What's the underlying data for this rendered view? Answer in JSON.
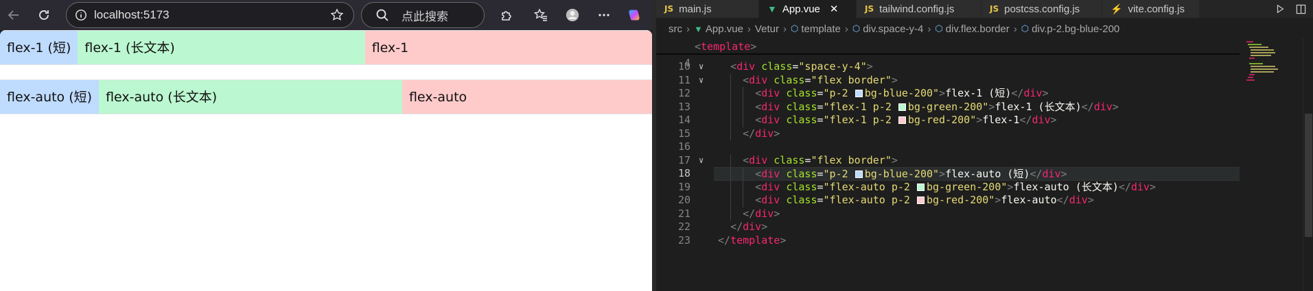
{
  "browser": {
    "url": "localhost:5173",
    "search_placeholder": "点此搜索"
  },
  "page": {
    "row1": [
      "flex-1 (短)",
      "flex-1 (长文本)",
      "flex-1"
    ],
    "row2": [
      "flex-auto (短)",
      "flex-auto (长文本)",
      "flex-auto"
    ]
  },
  "editor": {
    "tabs": [
      {
        "icon": "JS",
        "label": "main.js"
      },
      {
        "icon": "vue",
        "label": "App.vue",
        "close": "✕"
      },
      {
        "icon": "JS",
        "label": "tailwind.config.js"
      },
      {
        "icon": "JS",
        "label": "postcss.config.js"
      },
      {
        "icon": "vite",
        "label": "vite.config.js"
      }
    ],
    "breadcrumb": [
      "src",
      "App.vue",
      "Vetur",
      "template",
      "div.space-y-4",
      "div.flex.border",
      "div.p-2.bg-blue-200"
    ],
    "sticky_line": {
      "num": "4",
      "tag": "template"
    },
    "current_line": "18",
    "lines": [
      {
        "num": "10",
        "fold": "∨",
        "indent": 1,
        "tokens": [
          [
            "punc",
            "<"
          ],
          [
            "tag",
            "div"
          ],
          [
            "txt",
            " "
          ],
          [
            "attr",
            "class"
          ],
          [
            "eq",
            "="
          ],
          [
            "str",
            "\"space-y-4\""
          ],
          [
            "punc",
            ">"
          ]
        ]
      },
      {
        "num": "11",
        "fold": "∨",
        "indent": 2,
        "tokens": [
          [
            "punc",
            "<"
          ],
          [
            "tag",
            "div"
          ],
          [
            "txt",
            " "
          ],
          [
            "attr",
            "class"
          ],
          [
            "eq",
            "="
          ],
          [
            "str",
            "\"flex border\""
          ],
          [
            "punc",
            ">"
          ]
        ]
      },
      {
        "num": "12",
        "fold": "",
        "indent": 3,
        "tokens": [
          [
            "punc",
            "<"
          ],
          [
            "tag",
            "div"
          ],
          [
            "txt",
            " "
          ],
          [
            "attr",
            "class"
          ],
          [
            "eq",
            "="
          ],
          [
            "str",
            "\"p-2 "
          ],
          [
            "sw",
            "#bfdbfe"
          ],
          [
            "str",
            "bg-blue-200\""
          ],
          [
            "punc",
            ">"
          ],
          [
            "txt",
            "flex-1 (短)"
          ],
          [
            "punc",
            "</"
          ],
          [
            "tag",
            "div"
          ],
          [
            "punc",
            ">"
          ]
        ]
      },
      {
        "num": "13",
        "fold": "",
        "indent": 3,
        "tokens": [
          [
            "punc",
            "<"
          ],
          [
            "tag",
            "div"
          ],
          [
            "txt",
            " "
          ],
          [
            "attr",
            "class"
          ],
          [
            "eq",
            "="
          ],
          [
            "str",
            "\"flex-1 p-2 "
          ],
          [
            "sw",
            "#bbf7d0"
          ],
          [
            "str",
            "bg-green-200\""
          ],
          [
            "punc",
            ">"
          ],
          [
            "txt",
            "flex-1 (长文本)"
          ],
          [
            "punc",
            "</"
          ],
          [
            "tag",
            "div"
          ],
          [
            "punc",
            ">"
          ]
        ]
      },
      {
        "num": "14",
        "fold": "",
        "indent": 3,
        "tokens": [
          [
            "punc",
            "<"
          ],
          [
            "tag",
            "div"
          ],
          [
            "txt",
            " "
          ],
          [
            "attr",
            "class"
          ],
          [
            "eq",
            "="
          ],
          [
            "str",
            "\"flex-1 p-2 "
          ],
          [
            "sw",
            "#fecaca"
          ],
          [
            "str",
            "bg-red-200\""
          ],
          [
            "punc",
            ">"
          ],
          [
            "txt",
            "flex-1"
          ],
          [
            "punc",
            "</"
          ],
          [
            "tag",
            "div"
          ],
          [
            "punc",
            ">"
          ]
        ]
      },
      {
        "num": "15",
        "fold": "",
        "indent": 2,
        "tokens": [
          [
            "punc",
            "</"
          ],
          [
            "tag",
            "div"
          ],
          [
            "punc",
            ">"
          ]
        ]
      },
      {
        "num": "16",
        "fold": "",
        "indent": 0,
        "tokens": []
      },
      {
        "num": "17",
        "fold": "∨",
        "indent": 2,
        "tokens": [
          [
            "punc",
            "<"
          ],
          [
            "tag",
            "div"
          ],
          [
            "txt",
            " "
          ],
          [
            "attr",
            "class"
          ],
          [
            "eq",
            "="
          ],
          [
            "str",
            "\"flex border\""
          ],
          [
            "punc",
            ">"
          ]
        ]
      },
      {
        "num": "18",
        "fold": "",
        "indent": 3,
        "tokens": [
          [
            "punc",
            "<"
          ],
          [
            "tag",
            "div"
          ],
          [
            "txt",
            " "
          ],
          [
            "attr",
            "class"
          ],
          [
            "eq",
            "="
          ],
          [
            "str",
            "\"p-2 "
          ],
          [
            "sw",
            "#bfdbfe"
          ],
          [
            "str",
            "bg-blue-200\""
          ],
          [
            "punc",
            ">"
          ],
          [
            "txt",
            "flex-auto (短)"
          ],
          [
            "punc",
            "</"
          ],
          [
            "tag",
            "div"
          ],
          [
            "punc",
            ">"
          ]
        ]
      },
      {
        "num": "19",
        "fold": "",
        "indent": 3,
        "tokens": [
          [
            "punc",
            "<"
          ],
          [
            "tag",
            "div"
          ],
          [
            "txt",
            " "
          ],
          [
            "attr",
            "class"
          ],
          [
            "eq",
            "="
          ],
          [
            "str",
            "\"flex-auto p-2 "
          ],
          [
            "sw",
            "#bbf7d0"
          ],
          [
            "str",
            "bg-green-200\""
          ],
          [
            "punc",
            ">"
          ],
          [
            "txt",
            "flex-auto (长文本)"
          ],
          [
            "punc",
            "</"
          ],
          [
            "tag",
            "div"
          ],
          [
            "punc",
            ">"
          ]
        ]
      },
      {
        "num": "20",
        "fold": "",
        "indent": 3,
        "tokens": [
          [
            "punc",
            "<"
          ],
          [
            "tag",
            "div"
          ],
          [
            "txt",
            " "
          ],
          [
            "attr",
            "class"
          ],
          [
            "eq",
            "="
          ],
          [
            "str",
            "\"flex-auto p-2 "
          ],
          [
            "sw",
            "#fecaca"
          ],
          [
            "str",
            "bg-red-200\""
          ],
          [
            "punc",
            ">"
          ],
          [
            "txt",
            "flex-auto"
          ],
          [
            "punc",
            "</"
          ],
          [
            "tag",
            "div"
          ],
          [
            "punc",
            ">"
          ]
        ]
      },
      {
        "num": "21",
        "fold": "",
        "indent": 2,
        "tokens": [
          [
            "punc",
            "</"
          ],
          [
            "tag",
            "div"
          ],
          [
            "punc",
            ">"
          ]
        ]
      },
      {
        "num": "22",
        "fold": "",
        "indent": 1,
        "tokens": [
          [
            "punc",
            "</"
          ],
          [
            "tag",
            "div"
          ],
          [
            "punc",
            ">"
          ]
        ]
      },
      {
        "num": "23",
        "fold": "",
        "indent": 0,
        "tokens": [
          [
            "punc",
            "</"
          ],
          [
            "tag",
            "template"
          ],
          [
            "punc",
            ">"
          ]
        ]
      }
    ]
  }
}
